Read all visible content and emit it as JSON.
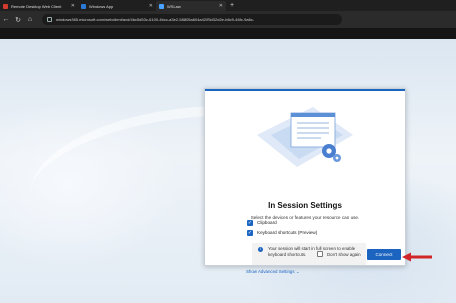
{
  "browser": {
    "tabs": [
      {
        "label": "Remote Desktop Web Client",
        "favicon_color": "#d23b2e"
      },
      {
        "label": "Windows App",
        "favicon_color": "#2a7ad5"
      },
      {
        "label": "WSLaw",
        "favicon_color": "#4aa3ff"
      }
    ],
    "url": "windows365.microsoft.com/webclient/avd/4bc5d53c-6100-4bcc-a3e2-58805a604a42/f5d32d2e-b6c9-46fc-9a6c-"
  },
  "dialog": {
    "title": "In Session Settings",
    "subtitle": "Select the devices or features your resource can use.",
    "options": [
      {
        "label": "Clipboard",
        "checked": true
      },
      {
        "label": "Keyboard shortcuts (Preview)",
        "checked": true
      }
    ],
    "info_text": "Your session will start in full screen to enable keyboard shortcuts.",
    "advanced_link": "Show Advanced Settings",
    "dont_show_label": "Don't show again",
    "connect_label": "Connect"
  },
  "colors": {
    "accent": "#1b64c0",
    "annotation_arrow": "#d0262a"
  }
}
